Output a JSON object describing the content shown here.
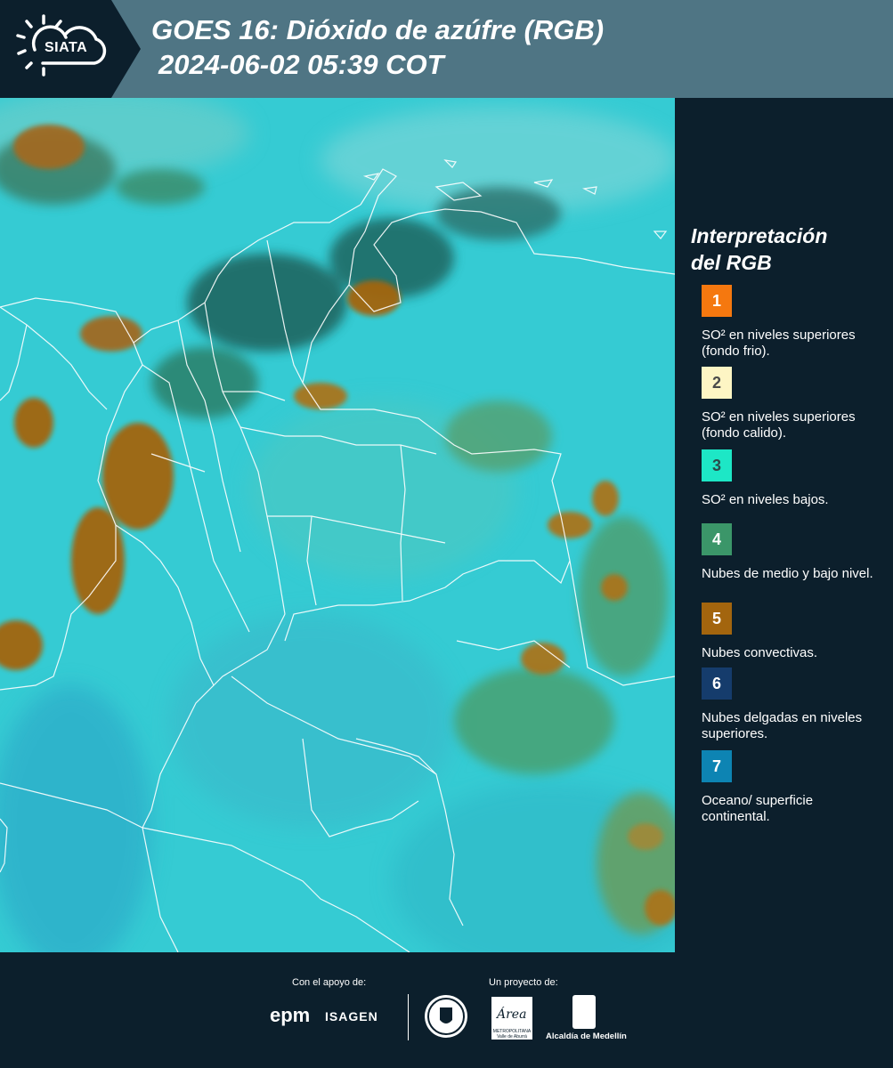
{
  "header": {
    "logo_text": "SIATA",
    "title_line1": "GOES 16: Dióxido de azúfre (RGB)",
    "title_line2": "2024-06-02 05:39 COT"
  },
  "legend": {
    "title_line1": "Interpretación",
    "title_line2": "del RGB",
    "items": [
      {
        "number": "1",
        "label": "SO² en niveles superiores (fondo frio).",
        "color": "#f5780f",
        "text_color": "#ffffff"
      },
      {
        "number": "2",
        "label": "SO² en niveles superiores (fondo calido).",
        "color": "#fdf5c4",
        "text_color": "#4a4a4a"
      },
      {
        "number": "3",
        "label": "SO² en niveles bajos.",
        "color": "#1de7c6",
        "text_color": "#2b4a4a"
      },
      {
        "number": "4",
        "label": "Nubes de medio y bajo nivel.",
        "color": "#3b9669",
        "text_color": "#ffffff"
      },
      {
        "number": "5",
        "label": "Nubes convectivas.",
        "color": "#a3650e",
        "text_color": "#ffffff"
      },
      {
        "number": "6",
        "label": "Nubes delgadas en niveles superiores.",
        "color": "#153c6c",
        "text_color": "#ffffff"
      },
      {
        "number": "7",
        "label": "Oceano/ superficie continental.",
        "color": "#0d84b3",
        "text_color": "#ffffff"
      }
    ]
  },
  "footer": {
    "support_label": "Con el apoyo de:",
    "project_label": "Un proyecto de:",
    "epm": "epm",
    "isagen": "ISAGEN",
    "area_caption": "METROPOLITANA Valle de Aburrá",
    "area_word": "Área",
    "alcaldia": "Alcaldía de Medellín"
  },
  "colors": {
    "background": "#0c1f2c",
    "header_band": "#4f7584",
    "map_base": "#35cbd3",
    "convective": "#a3650e",
    "mid_low_cloud": "#3b9669"
  }
}
